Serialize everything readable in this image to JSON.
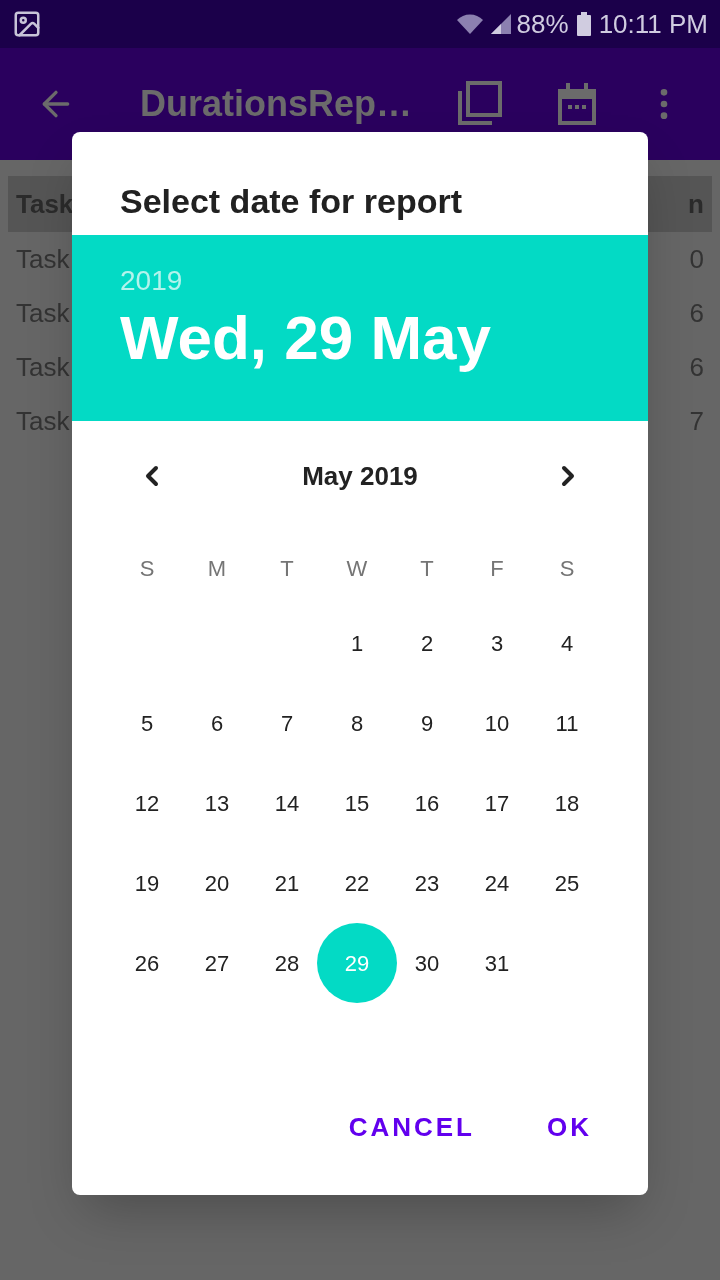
{
  "status_bar": {
    "battery": "88%",
    "time": "10:11 PM"
  },
  "app_bar": {
    "title": "DurationsRep…"
  },
  "table": {
    "header": [
      "Task",
      "n"
    ],
    "rows": [
      [
        "Task",
        "0"
      ],
      [
        "Task",
        "6"
      ],
      [
        "Task",
        "6"
      ],
      [
        "Task",
        "7"
      ]
    ]
  },
  "dialog": {
    "title": "Select date for report",
    "year": "2019",
    "date": "Wed, 29 May",
    "month": "May 2019",
    "weekdays": [
      "S",
      "M",
      "T",
      "W",
      "T",
      "F",
      "S"
    ],
    "weeks": [
      {
        "days": [
          {
            "day": "1",
            "selected": false
          },
          {
            "day": "2",
            "selected": false
          },
          {
            "day": "3",
            "selected": false
          },
          {
            "day": "4",
            "selected": false
          }
        ]
      },
      {
        "days": [
          {
            "day": "5",
            "selected": false
          },
          {
            "day": "6",
            "selected": false
          },
          {
            "day": "7",
            "selected": false
          },
          {
            "day": "8",
            "selected": false
          },
          {
            "day": "9",
            "selected": false
          },
          {
            "day": "10",
            "selected": false
          },
          {
            "day": "11",
            "selected": false
          }
        ]
      },
      {
        "days": [
          {
            "day": "12",
            "selected": false
          },
          {
            "day": "13",
            "selected": false
          },
          {
            "day": "14",
            "selected": false
          },
          {
            "day": "15",
            "selected": false
          },
          {
            "day": "16",
            "selected": false
          },
          {
            "day": "17",
            "selected": false
          },
          {
            "day": "18",
            "selected": false
          }
        ]
      },
      {
        "days": [
          {
            "day": "19",
            "selected": false
          },
          {
            "day": "20",
            "selected": false
          },
          {
            "day": "21",
            "selected": false
          },
          {
            "day": "22",
            "selected": false
          },
          {
            "day": "23",
            "selected": false
          },
          {
            "day": "24",
            "selected": false
          },
          {
            "day": "25",
            "selected": false
          }
        ]
      },
      {
        "days": [
          {
            "day": "26",
            "selected": false
          },
          {
            "day": "27",
            "selected": false
          },
          {
            "day": "28",
            "selected": false
          },
          {
            "day": "29",
            "selected": true
          },
          {
            "day": "30",
            "selected": false
          },
          {
            "day": "31",
            "selected": false
          }
        ]
      }
    ],
    "buttons": [
      "CANCEL",
      "OK"
    ]
  }
}
